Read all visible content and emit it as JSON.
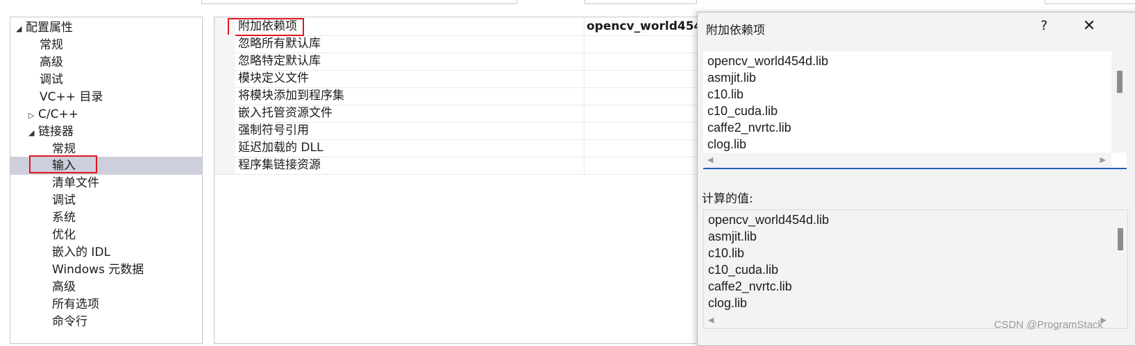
{
  "tree": {
    "root": "配置属性",
    "items": {
      "general": "常规",
      "advanced": "高级",
      "debugging": "调试",
      "vc_dirs": "VC++ 目录",
      "cpp": "C/C++",
      "linker": "链接器"
    },
    "linker_children": {
      "general": "常规",
      "input": "输入",
      "manifest": "清单文件",
      "debugging": "调试",
      "system": "系统",
      "optimization": "优化",
      "embedded_idl": "嵌入的 IDL",
      "windows_metadata": "Windows 元数据",
      "advanced": "高级",
      "all_options": "所有选项",
      "command_line": "命令行"
    },
    "expanded_glyph": "◢",
    "collapsed_glyph": "▷"
  },
  "grid": {
    "rows": [
      {
        "name": "附加依赖项",
        "value": "opencv_world454"
      },
      {
        "name": "忽略所有默认库",
        "value": ""
      },
      {
        "name": "忽略特定默认库",
        "value": ""
      },
      {
        "name": "模块定义文件",
        "value": ""
      },
      {
        "name": "将模块添加到程序集",
        "value": ""
      },
      {
        "name": "嵌入托管资源文件",
        "value": ""
      },
      {
        "name": "强制符号引用",
        "value": ""
      },
      {
        "name": "延迟加载的 DLL",
        "value": ""
      },
      {
        "name": "程序集链接资源",
        "value": ""
      }
    ]
  },
  "dialog": {
    "title": "附加依赖项",
    "help_glyph": "?",
    "close_glyph": "✕",
    "entries": [
      "opencv_world454d.lib",
      "asmjit.lib",
      "c10.lib",
      "c10_cuda.lib",
      "caffe2_nvrtc.lib",
      "clog.lib"
    ],
    "computed_label": "计算的值:",
    "computed": [
      "opencv_world454d.lib",
      "asmjit.lib",
      "c10.lib",
      "c10_cuda.lib",
      "caffe2_nvrtc.lib",
      "clog.lib"
    ]
  },
  "watermark": "CSDN @ProgramStack",
  "colors": {
    "highlight_box": "#e0141e",
    "selection": "#cdd0dc",
    "focus_underline": "#1a5fb4"
  }
}
